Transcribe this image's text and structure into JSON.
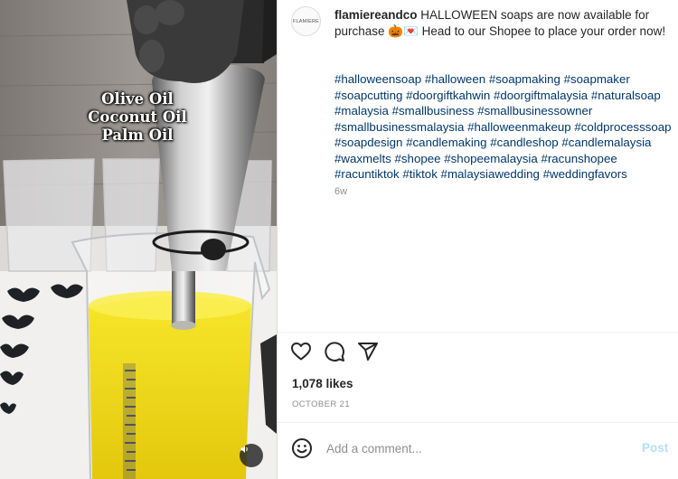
{
  "media": {
    "overlay_lines": [
      "Olive Oil",
      "Coconut Oil",
      "Palm Oil"
    ],
    "mute_icon": "volume-icon"
  },
  "post": {
    "avatar_text": "FLAMIERE",
    "username": "flamiereandco",
    "caption_text": " HALLOWEEN soaps are now available for purchase 🎃💌 Head to our Shopee to place your order now!",
    "hashtags": [
      "#halloweensoap",
      "#halloween",
      "#soapmaking",
      "#soapmaker",
      "#soapcutting",
      "#doorgiftkahwin",
      "#doorgiftmalaysia",
      "#naturalsoap",
      "#malaysia",
      "#smallbusiness",
      "#smallbusinessowner",
      "#smallbusinessmalaysia",
      "#halloweenmakeup",
      "#coldprocesssoap",
      "#soapdesign",
      "#candlemaking",
      "#candleshop",
      "#candlemalaysia",
      "#waxmelts",
      "#shopee",
      "#shopeemalaysia",
      "#racunshopee",
      "#racuntiktok",
      "#tiktok",
      "#malaysiawedding",
      "#weddingfavors"
    ],
    "time_ago": "6w",
    "likes": "1,078 likes",
    "date": "OCTOBER 21"
  },
  "actions": {
    "like_icon": "heart-icon",
    "comment_icon": "comment-icon",
    "share_icon": "share-icon"
  },
  "comment_box": {
    "emoji_icon": "emoji-icon",
    "placeholder": "Add a comment...",
    "value": "",
    "post_label": "Post"
  }
}
